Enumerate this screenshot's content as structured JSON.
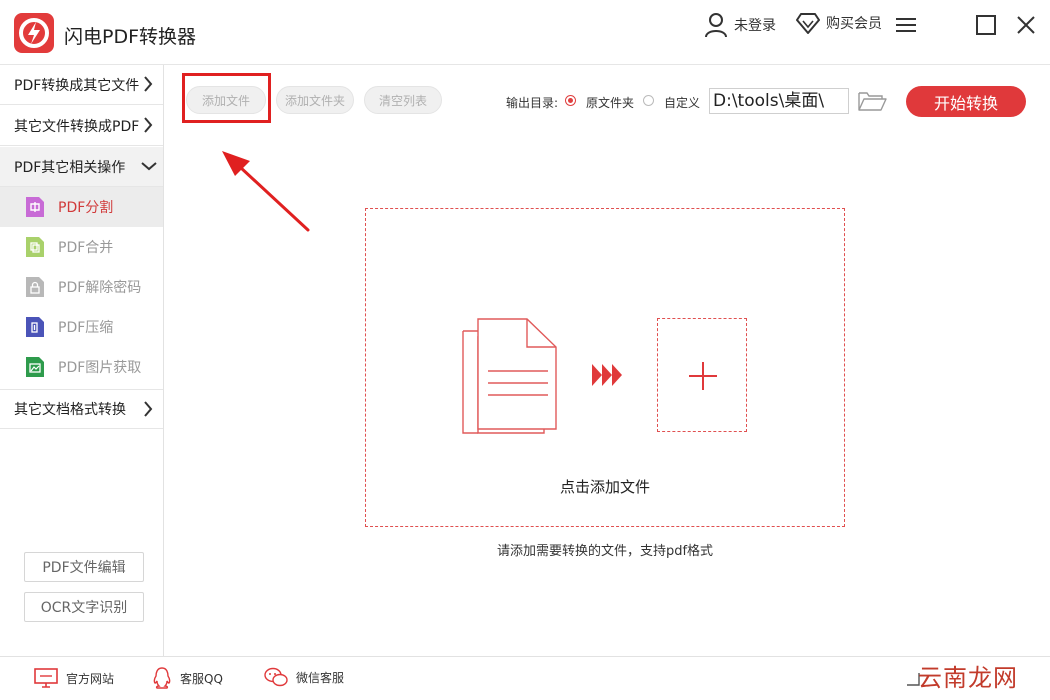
{
  "app": {
    "title": "闪电PDF转换器"
  },
  "titlebar": {
    "user_label": "未登录",
    "vip_label": "购买会员"
  },
  "sidebar": {
    "groups": [
      {
        "label": "PDF转换成其它文件"
      },
      {
        "label": "其它文件转换成PDF"
      },
      {
        "label": "PDF其它相关操作"
      },
      {
        "label": "其它文档格式转换"
      }
    ],
    "items": [
      {
        "label": "PDF分割",
        "active": true
      },
      {
        "label": "PDF合并"
      },
      {
        "label": "PDF解除密码"
      },
      {
        "label": "PDF压缩"
      },
      {
        "label": "PDF图片获取"
      }
    ],
    "bottom_buttons": [
      {
        "label": "PDF文件编辑"
      },
      {
        "label": "OCR文字识别"
      }
    ]
  },
  "toolbar": {
    "add_file": "添加文件",
    "add_folder": "添加文件夹",
    "clear_list": "清空列表",
    "output_label": "输出目录:",
    "radio_original": "原文件夹",
    "radio_custom": "自定义",
    "path_value": "D:\\tools\\桌面\\",
    "start_label": "开始转换"
  },
  "dropzone": {
    "label": "点击添加文件",
    "hint": "请添加需要转换的文件，支持pdf格式"
  },
  "footer": {
    "website": "官方网站",
    "qq": "客服QQ",
    "wechat": "微信客服"
  },
  "watermark": {
    "text": "云南龙网"
  },
  "colors": {
    "accent": "#e0393b",
    "highlight": "#e02020"
  }
}
